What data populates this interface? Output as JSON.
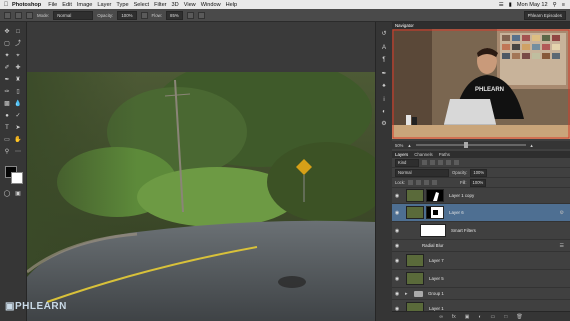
{
  "menubar": {
    "apple_icon": "apple-icon",
    "app_name": "Photoshop",
    "items": [
      "File",
      "Edit",
      "Image",
      "Layer",
      "Type",
      "Select",
      "Filter",
      "3D",
      "View",
      "Window",
      "Help"
    ],
    "clock": "Mon May 12",
    "status_icons": [
      "wifi-icon",
      "battery-icon",
      "search-icon",
      "list-icon"
    ]
  },
  "options": {
    "mode_label": "Mode:",
    "mode_value": "Normal",
    "opacity_label": "Opacity:",
    "opacity_value": "100%",
    "flow_label": "Flow:",
    "flow_value": "85%",
    "workspace": "Phlearn Episodes"
  },
  "navigator": {
    "tab": "Navigator",
    "zoom": "50%",
    "brand_text": "PHLEARN"
  },
  "layers_panel": {
    "tabs": [
      "Layers",
      "Channels",
      "Paths"
    ],
    "filter_kind": "Kind",
    "blend_mode": "Normal",
    "opacity_label": "Opacity:",
    "opacity_value": "100%",
    "lock_label": "Lock:",
    "fill_label": "Fill:",
    "fill_value": "100%",
    "layers": [
      {
        "name": "Layer 1 copy",
        "visible": true
      },
      {
        "name": "Layer 6",
        "visible": true,
        "selected": true
      },
      {
        "name": "Smart Filters",
        "visible": true
      },
      {
        "name": "Radial Blur",
        "visible": true
      },
      {
        "name": "Layer 7",
        "visible": true
      },
      {
        "name": "Layer 5",
        "visible": true
      },
      {
        "name": "Group 1",
        "visible": true
      },
      {
        "name": "Layer 1",
        "visible": true
      }
    ]
  },
  "watermark": "PHLEARN"
}
